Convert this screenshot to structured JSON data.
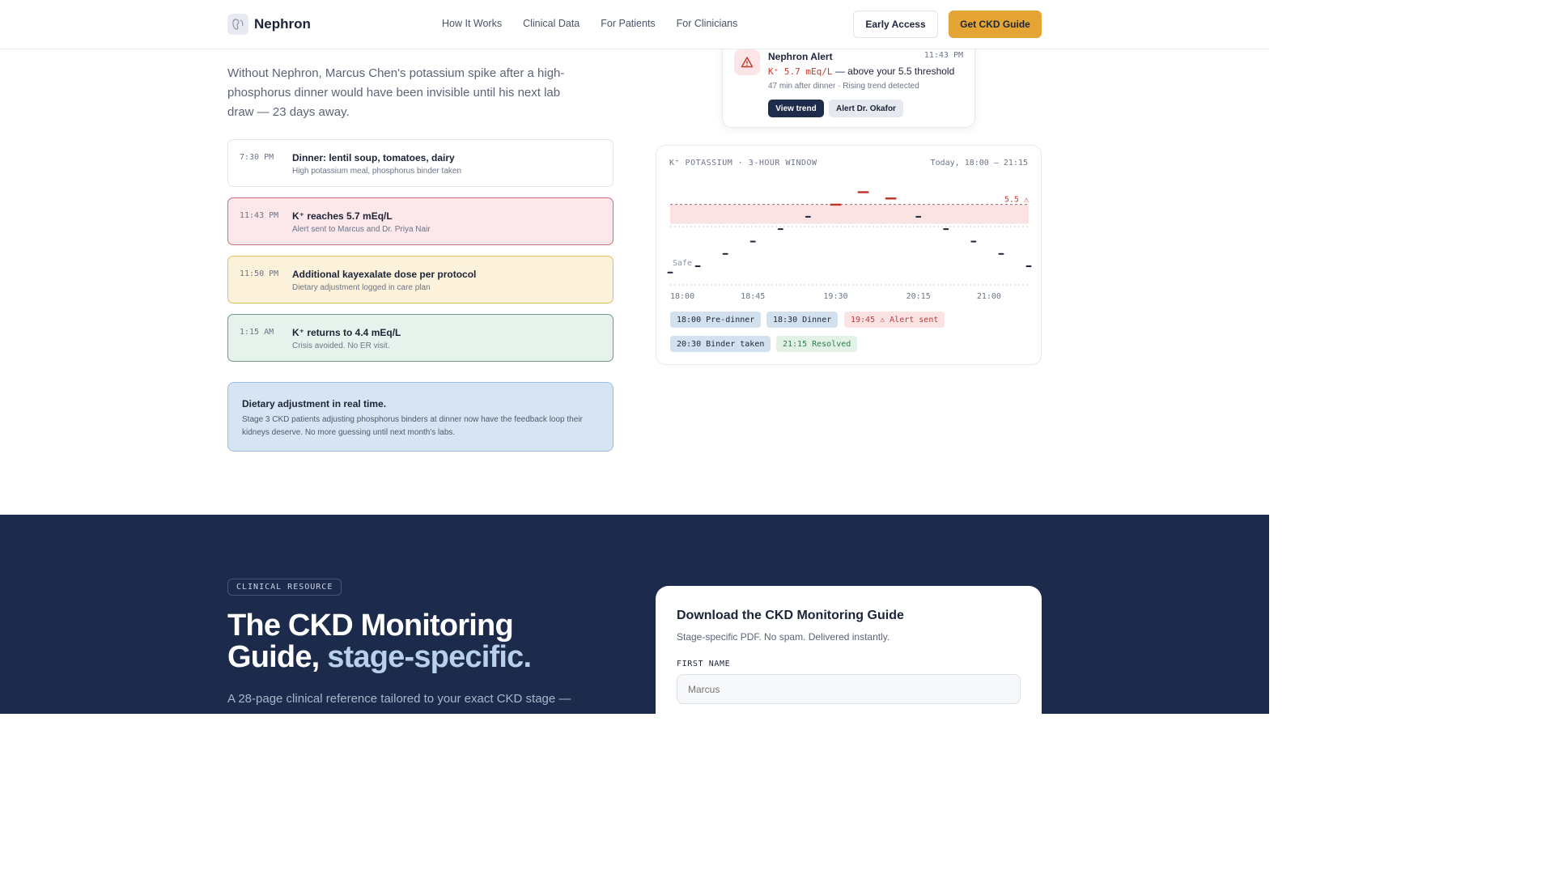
{
  "nav": {
    "brand": "Nephron",
    "links": [
      "How It Works",
      "Clinical Data",
      "For Patients",
      "For Clinicians"
    ],
    "early_access": "Early Access",
    "guide_button": "Get CKD Guide"
  },
  "story": {
    "lead": "Without Nephron, Marcus Chen's potassium spike after a high-phosphorus dinner would have been invisible until his next lab draw — 23 days away.",
    "timeline": [
      {
        "time": "7:30 PM",
        "title": "Dinner: lentil soup, tomatoes, dairy",
        "detail": "High potassium meal, phosphorus binder taken",
        "status": "neutral"
      },
      {
        "time": "11:43 PM",
        "title": "K⁺ reaches 5.7 mEq/L",
        "detail": "Alert sent to Marcus and Dr. Priya Nair",
        "status": "alert"
      },
      {
        "time": "11:50 PM",
        "title": "Additional kayexalate dose per protocol",
        "detail": "Dietary adjustment logged in care plan",
        "status": "warning"
      },
      {
        "time": "1:15 AM",
        "title": "K⁺ returns to 4.4 mEq/L",
        "detail": "Crisis avoided. No ER visit.",
        "status": "resolved"
      }
    ],
    "callout": {
      "title": "Dietary adjustment in real time.",
      "body": "Stage 3 CKD patients adjusting phosphorus binders at dinner now have the feedback loop their kidneys deserve. No more guessing until next month's labs."
    }
  },
  "alert_card": {
    "title": "Nephron Alert",
    "time": "11:43 PM",
    "value": "K⁺ 5.7 mEq/L",
    "message": "— above your 5.5 threshold",
    "meta": "47 min after dinner · Rising trend detected",
    "primary_action": "View trend",
    "secondary_action": "Alert Dr. Okafor"
  },
  "chart_card": {
    "title": "K⁺ POTASSIUM · 3-HOUR WINDOW",
    "range": "Today, 18:00 – 21:15",
    "threshold_label": "5.5 ⚠",
    "safe_label": "Safe",
    "events": [
      {
        "label": "18:00 Pre-dinner",
        "tone": "blue"
      },
      {
        "label": "18:30 Dinner",
        "tone": "blue"
      },
      {
        "label": "19:45 ⚠ Alert sent",
        "tone": "red"
      },
      {
        "label": "20:30 Binder taken",
        "tone": "blue"
      },
      {
        "label": "21:15 Resolved",
        "tone": "green"
      }
    ]
  },
  "chart_data": {
    "type": "scatter",
    "title": "K⁺ POTASSIUM · 3-HOUR WINDOW",
    "xlabel": "",
    "ylabel": "",
    "x_ticks": [
      "18:00",
      "18:45",
      "19:30",
      "20:15",
      "21:00"
    ],
    "x": [
      "18:00",
      "18:15",
      "18:30",
      "18:45",
      "19:00",
      "19:15",
      "19:30",
      "19:45",
      "20:00",
      "20:15",
      "20:30",
      "20:45",
      "21:00",
      "21:15"
    ],
    "y": [
      4.4,
      4.5,
      4.7,
      4.9,
      5.1,
      5.3,
      5.5,
      5.7,
      5.6,
      5.3,
      5.1,
      4.9,
      4.7,
      4.5
    ],
    "threshold": 5.5,
    "ylim": [
      4.2,
      5.9
    ],
    "grid": false,
    "colors": {
      "normal": "#1c2438",
      "alert": "#c0392b",
      "threshold_band": "#fbe3e4"
    }
  },
  "resource": {
    "pill": "CLINICAL RESOURCE",
    "title_main": "The CKD Monitoring Guide, ",
    "title_accent": "stage-specific.",
    "body": "A 28-page clinical reference tailored to your exact CKD stage —",
    "form": {
      "title": "Download the CKD Monitoring Guide",
      "subtitle": "Stage-specific PDF. No spam. Delivered instantly.",
      "first_name_label": "FIRST NAME",
      "first_name_placeholder": "Marcus"
    }
  }
}
